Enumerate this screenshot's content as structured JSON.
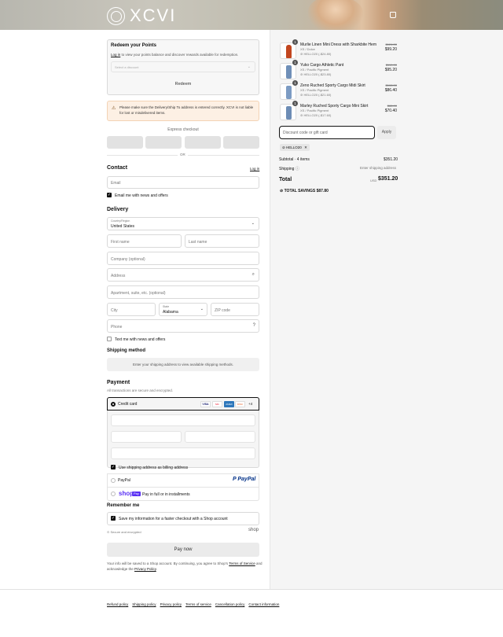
{
  "brand": {
    "logo_text": "XCVI",
    "logo_icon": "circle-logo-icon",
    "cart_icon": "bag-icon"
  },
  "rewards": {
    "title": "Redeem your Points",
    "login_link": "Log in",
    "desc": " to view your points balance and discover rewards available for redemption.",
    "select_placeholder": "Select a discount",
    "button": "Redeem"
  },
  "alert": {
    "icon": "warning-icon",
    "text": "Please make sure the Delivery/Ship To address is entered correctly. XCVI is not liable for lost or misdelivered items."
  },
  "express": {
    "label": "Express checkout",
    "or": "OR"
  },
  "contact": {
    "title": "Contact",
    "login_link": "Log in",
    "email_placeholder": "Email",
    "news_label": "Email me with news and offers"
  },
  "delivery": {
    "title": "Delivery",
    "country_label": "Country/Region",
    "country_value": "United States",
    "first_name": "First name",
    "last_name": "Last name",
    "company": "Company (optional)",
    "address": "Address",
    "apartment": "Apartment, suite, etc. (optional)",
    "city": "City",
    "state_label": "State",
    "state_value": "Alabama",
    "zip": "ZIP code",
    "phone": "Phone",
    "text_label": "Text me with news and offers"
  },
  "shipping_method": {
    "title": "Shipping method",
    "message": "Enter your shipping address to view available shipping methods."
  },
  "payment": {
    "title": "Payment",
    "subtitle": "All transactions are secure and encrypted.",
    "credit_card": "Credit card",
    "cards": [
      "VISA",
      "MC",
      "AMEX",
      "DISC"
    ],
    "more_cards": "+4",
    "billing_label": "Use shipping address as billing address",
    "paypal": "PayPal",
    "shop_pay_text": "Pay in full or in installments",
    "shop_logo": "shop",
    "shop_pay_badge": "Pay"
  },
  "remember": {
    "title": "Remember me",
    "save_label": "Save my information for a faster checkout with a Shop account",
    "secure": "Secure and encrypted",
    "shop_logo": "shop"
  },
  "pay_button": "Pay now",
  "legal": {
    "prefix": "Your info will be saved to a Shop account. By continuing, you agree to Shop's ",
    "terms": "Terms of Service",
    "middle": " and acknowledge the ",
    "privacy": "Privacy Policy",
    "suffix": "."
  },
  "footer": [
    "Refund policy",
    "Shipping policy",
    "Privacy policy",
    "Terms of service",
    "Cancellation policy",
    "Contact information"
  ],
  "products": [
    {
      "qty": "1",
      "name": "Murlie Linen Mini Dress with Sharkbite Hem",
      "variant": "XS / Dolce",
      "discount": "HELLO20 (-$24.80)",
      "old": "$124.00",
      "new": "$99.20",
      "color": "#c2461f"
    },
    {
      "qty": "1",
      "name": "Yuko Cargo Athletic Pant",
      "variant": "XS / Pacific Pigment",
      "discount": "HELLO20 (-$23.80)",
      "old": "$119.00",
      "new": "$95.20",
      "color": "#6f8fb8"
    },
    {
      "qty": "1",
      "name": "Zeno Ruched Sporty Cargo Midi Skirt",
      "variant": "XS / Pacific Pigment",
      "discount": "HELLO20 (-$21.60)",
      "old": "$108.00",
      "new": "$86.40",
      "color": "#7c9bc3"
    },
    {
      "qty": "1",
      "name": "Marley Ruched Sporty Cargo Mini Skirt",
      "variant": "XS / Pacific Pigment",
      "discount": "HELLO20 (-$17.60)",
      "old": "$88.00",
      "new": "$70.40",
      "color": "#6d8cb5"
    }
  ],
  "discount": {
    "placeholder": "Discount code or gift card",
    "apply": "Apply",
    "tag": "HELLO20"
  },
  "summary": {
    "subtotal_label": "Subtotal · 4 items",
    "subtotal_value": "$351.20",
    "shipping_label": "Shipping",
    "shipping_value": "Enter shipping address",
    "total_label": "Total",
    "currency": "USD",
    "total_value": "$351.20",
    "savings_label": "TOTAL SAVINGS",
    "savings_value": "$87.80"
  }
}
